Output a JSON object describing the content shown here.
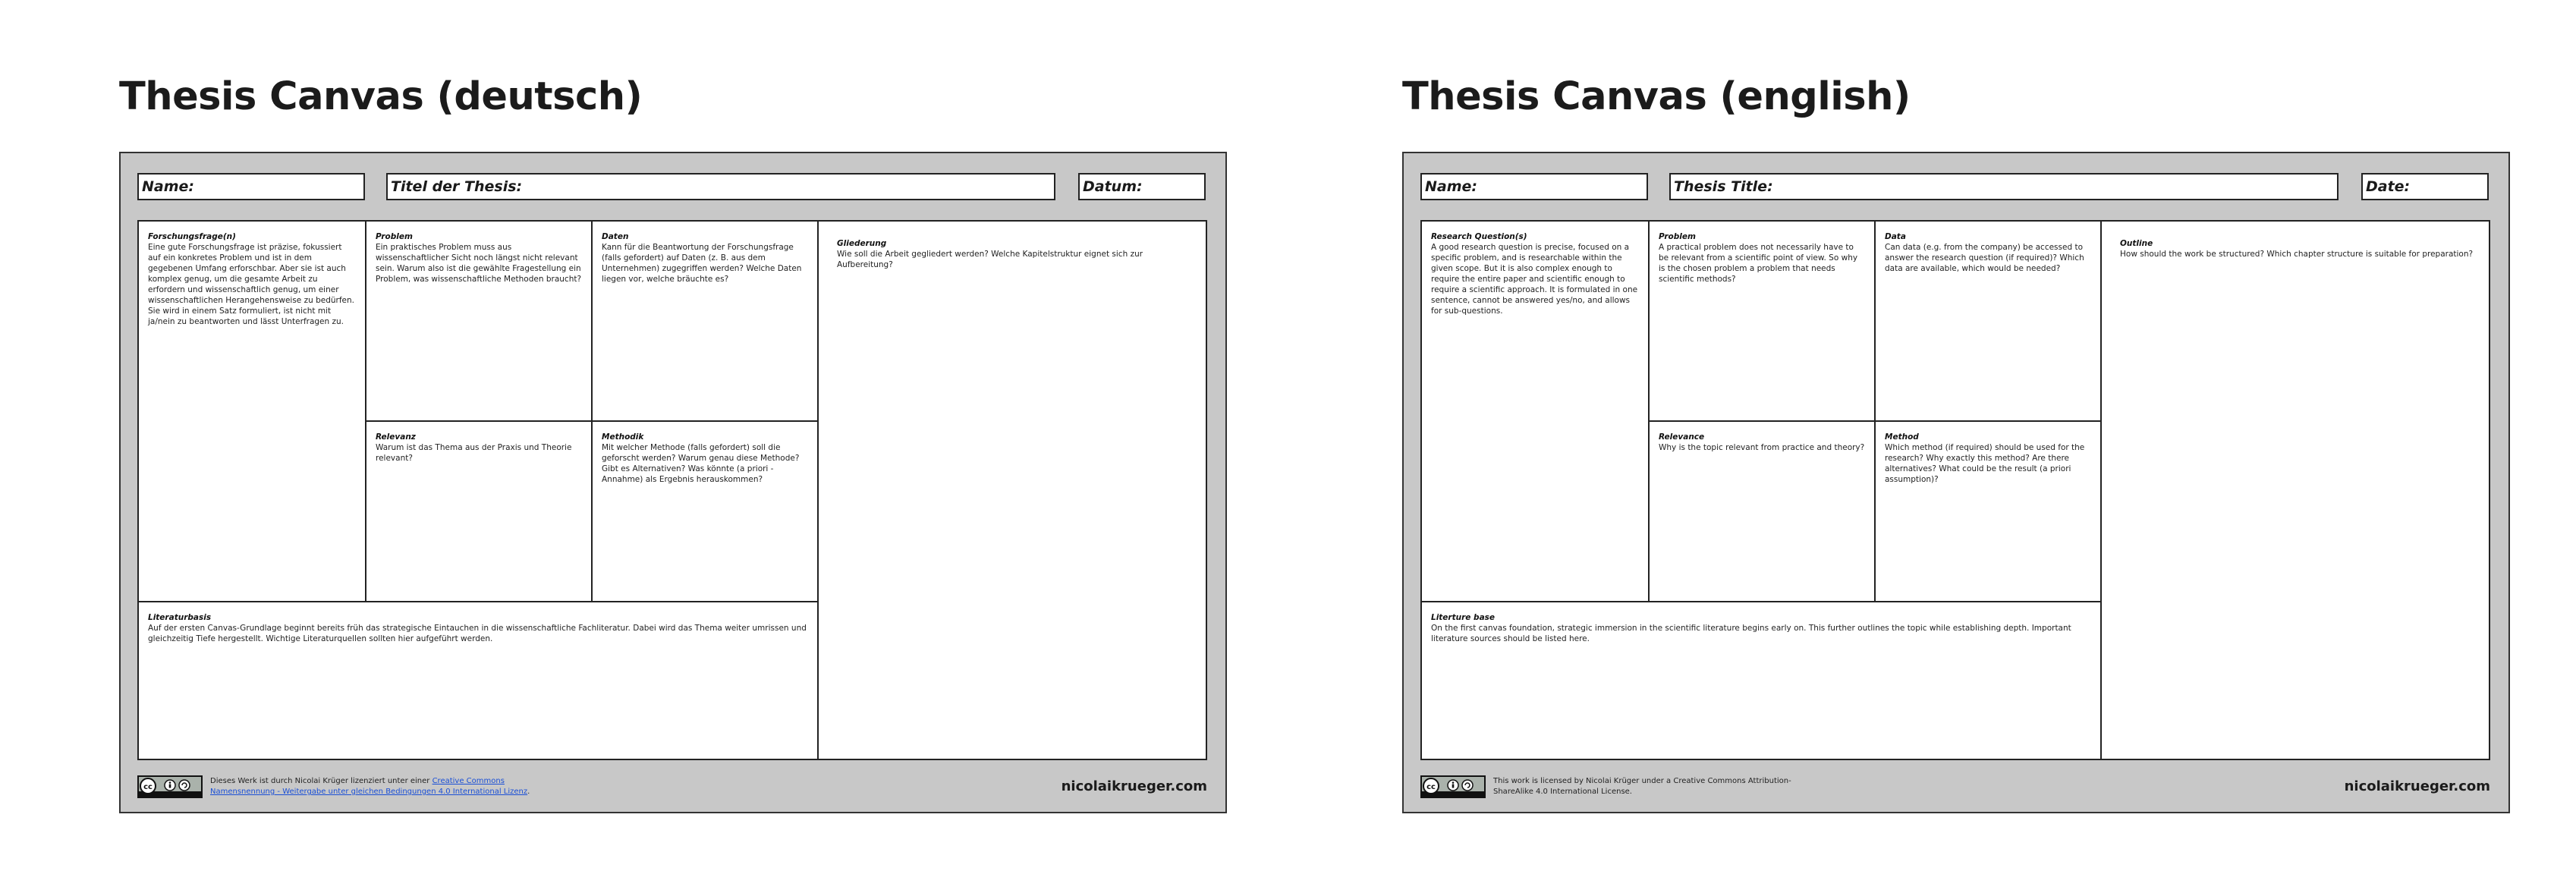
{
  "panels": [
    {
      "title": "Thesis Canvas (deutsch)",
      "fields": {
        "name": "Name:",
        "thesis_title": "Titel der Thesis:",
        "date": "Datum:"
      },
      "cells": {
        "research_question": {
          "heading": "Forschungsfrage(n)",
          "text": "Eine gute Forschungsfrage ist präzise, fokussiert auf ein konkretes Problem und ist in dem gegebenen Umfang erforschbar. Aber sie ist auch komplex genug, um die gesamte Arbeit zu erfordern und wissenschaftlich genug, um einer wissenschaftlichen Herangehensweise zu bedürfen. Sie wird in einem Satz formuliert, ist nicht mit ja/nein zu beantworten und lässt Unterfragen zu."
        },
        "problem": {
          "heading": "Problem",
          "text": "Ein praktisches Problem muss aus wissenschaftlicher Sicht noch längst nicht relevant sein. Warum also ist die gewählte Fragestellung ein Problem, was wissenschaftliche Methoden braucht?"
        },
        "data": {
          "heading": "Daten",
          "text": "Kann für die Beantwortung der Forschungsfrage (falls gefordert) auf Daten (z. B. aus dem Unternehmen) zugegriffen werden? Welche Daten liegen vor, welche bräuchte es?"
        },
        "relevance": {
          "heading": "Relevanz",
          "text": "Warum ist das Thema aus der Praxis und Theorie relevant?"
        },
        "method": {
          "heading": "Methodik",
          "text": "Mit welcher Methode (falls gefordert) soll die geforscht werden? Warum genau diese Methode? Gibt es Alternativen? Was könnte (a priori - Annahme) als Ergebnis herauskommen?"
        },
        "literature": {
          "heading": "Literaturbasis",
          "text": "Auf der ersten Canvas-Grundlage beginnt bereits früh das strategische Eintauchen in die wissenschaftliche Fachliteratur. Dabei wird das Thema weiter umrissen und gleichzeitig Tiefe hergestellt. Wichtige Literaturquellen sollten hier aufgeführt werden."
        },
        "outline": {
          "heading": "Gliederung",
          "text": "Wie soll die Arbeit gegliedert werden? Welche Kapitelstruktur eignet sich zur Aufbereitung?"
        }
      },
      "footer": {
        "license_prefix": "Dieses Werk ist durch Nicolai Krüger lizenziert unter einer ",
        "license_link_1": "Creative Commons",
        "license_link_2": "Namensnennung - Weitergabe unter gleichen Bedingungen 4.0 International Lizenz",
        "license_suffix": ".",
        "website": "nicolaikrueger.com"
      }
    },
    {
      "title": "Thesis Canvas (english)",
      "fields": {
        "name": "Name:",
        "thesis_title": "Thesis Title:",
        "date": "Date:"
      },
      "cells": {
        "research_question": {
          "heading": "Research Question(s)",
          "text": "A good research question is precise, focused on a specific problem, and is researchable within the given scope. But it is also complex enough to require the entire paper and scientific enough to require a scientific approach. It is formulated in one sentence, cannot be answered yes/no, and allows for sub-questions."
        },
        "problem": {
          "heading": "Problem",
          "text": "A practical problem does not necessarily have to be relevant from a scientific point of view. So why is the chosen problem a problem that needs scientific methods?"
        },
        "data": {
          "heading": "Data",
          "text": "Can data (e.g. from the company) be accessed to answer the research question (if required)? Which data are available, which would be needed?"
        },
        "relevance": {
          "heading": "Relevance",
          "text": "Why is the topic relevant from practice and theory?"
        },
        "method": {
          "heading": "Method",
          "text": "Which method (if required) should be used for the research? Why exactly this method? Are there alternatives? What could be the result (a priori assumption)?"
        },
        "literature": {
          "heading": "Literture base",
          "text": "On the first canvas foundation, strategic immersion in the scientific literature begins early on. This further outlines the topic while establishing depth. Important literature sources should be listed here."
        },
        "outline": {
          "heading": "Outline",
          "text": "How should the work be structured? Which chapter structure is suitable for preparation?"
        }
      },
      "footer": {
        "license_text": "This work is licensed by Nicolai Krüger under a Creative Commons Attribution-ShareAlike 4.0 International License.",
        "website": "nicolaikrueger.com"
      }
    }
  ]
}
